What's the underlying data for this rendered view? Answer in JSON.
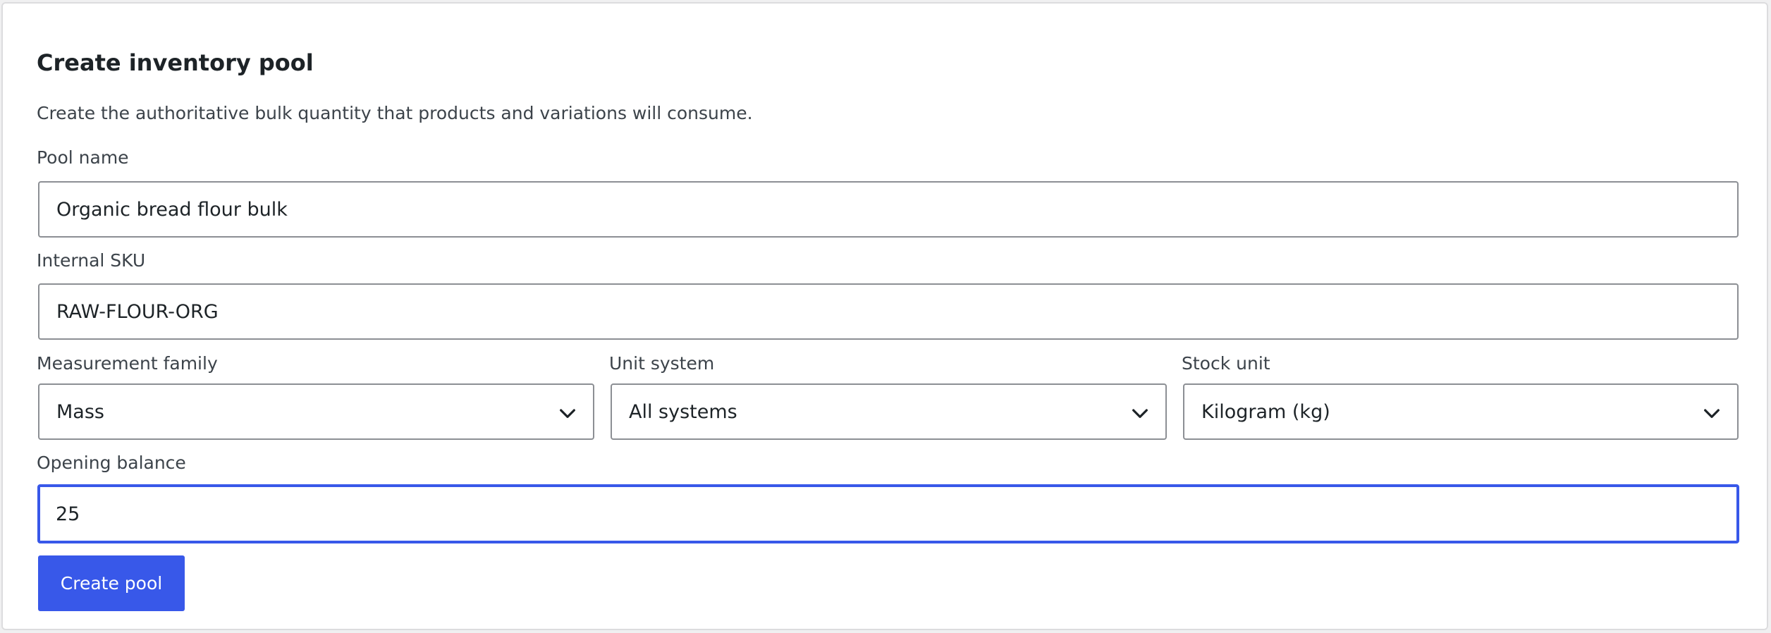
{
  "form": {
    "title": "Create inventory pool",
    "description": "Create the authoritative bulk quantity that products and variations will consume.",
    "pool_name": {
      "label": "Pool name",
      "value": "Organic bread flour bulk"
    },
    "internal_sku": {
      "label": "Internal SKU",
      "value": "RAW-FLOUR-ORG"
    },
    "measurement_family": {
      "label": "Measurement family",
      "selected": "Mass"
    },
    "unit_system": {
      "label": "Unit system",
      "selected": "All systems"
    },
    "stock_unit": {
      "label": "Stock unit",
      "selected": "Kilogram (kg)"
    },
    "opening_balance": {
      "label": "Opening balance",
      "value": "25"
    },
    "submit_label": "Create pool"
  },
  "colors": {
    "accent": "#3858e9",
    "border": "#8c8f94",
    "card_border": "#dcdcde",
    "text": "#1d2327",
    "muted_text": "#3c434a"
  },
  "icons": {
    "select_chevron": "chevron-down-icon"
  }
}
